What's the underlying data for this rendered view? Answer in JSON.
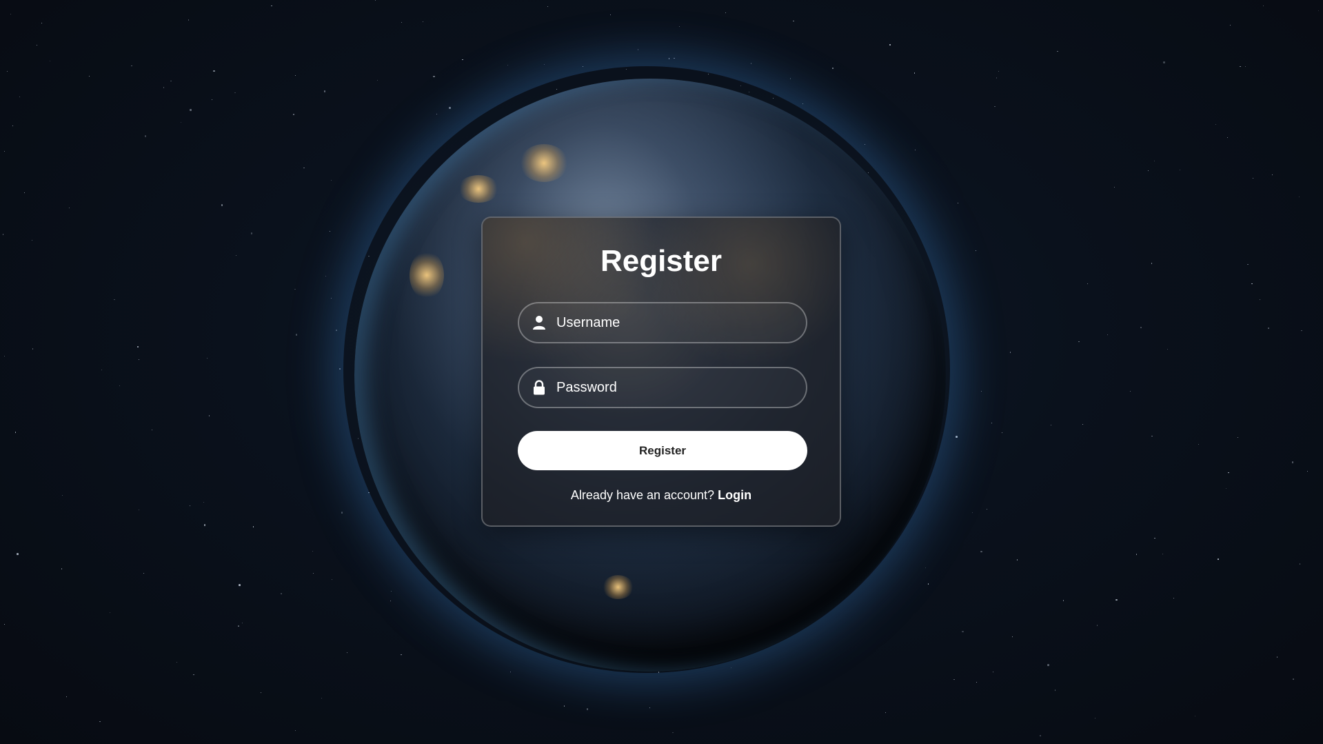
{
  "form": {
    "title": "Register",
    "username_placeholder": "Username",
    "password_placeholder": "Password",
    "submit_label": "Register",
    "footer_prompt": "Already have an account?",
    "footer_link": "Login"
  },
  "icons": {
    "username": "user-icon",
    "password": "lock-icon"
  },
  "colors": {
    "card_border": "#ffffff",
    "button_bg": "#ffffff",
    "button_text": "#222222",
    "text": "#ffffff"
  }
}
